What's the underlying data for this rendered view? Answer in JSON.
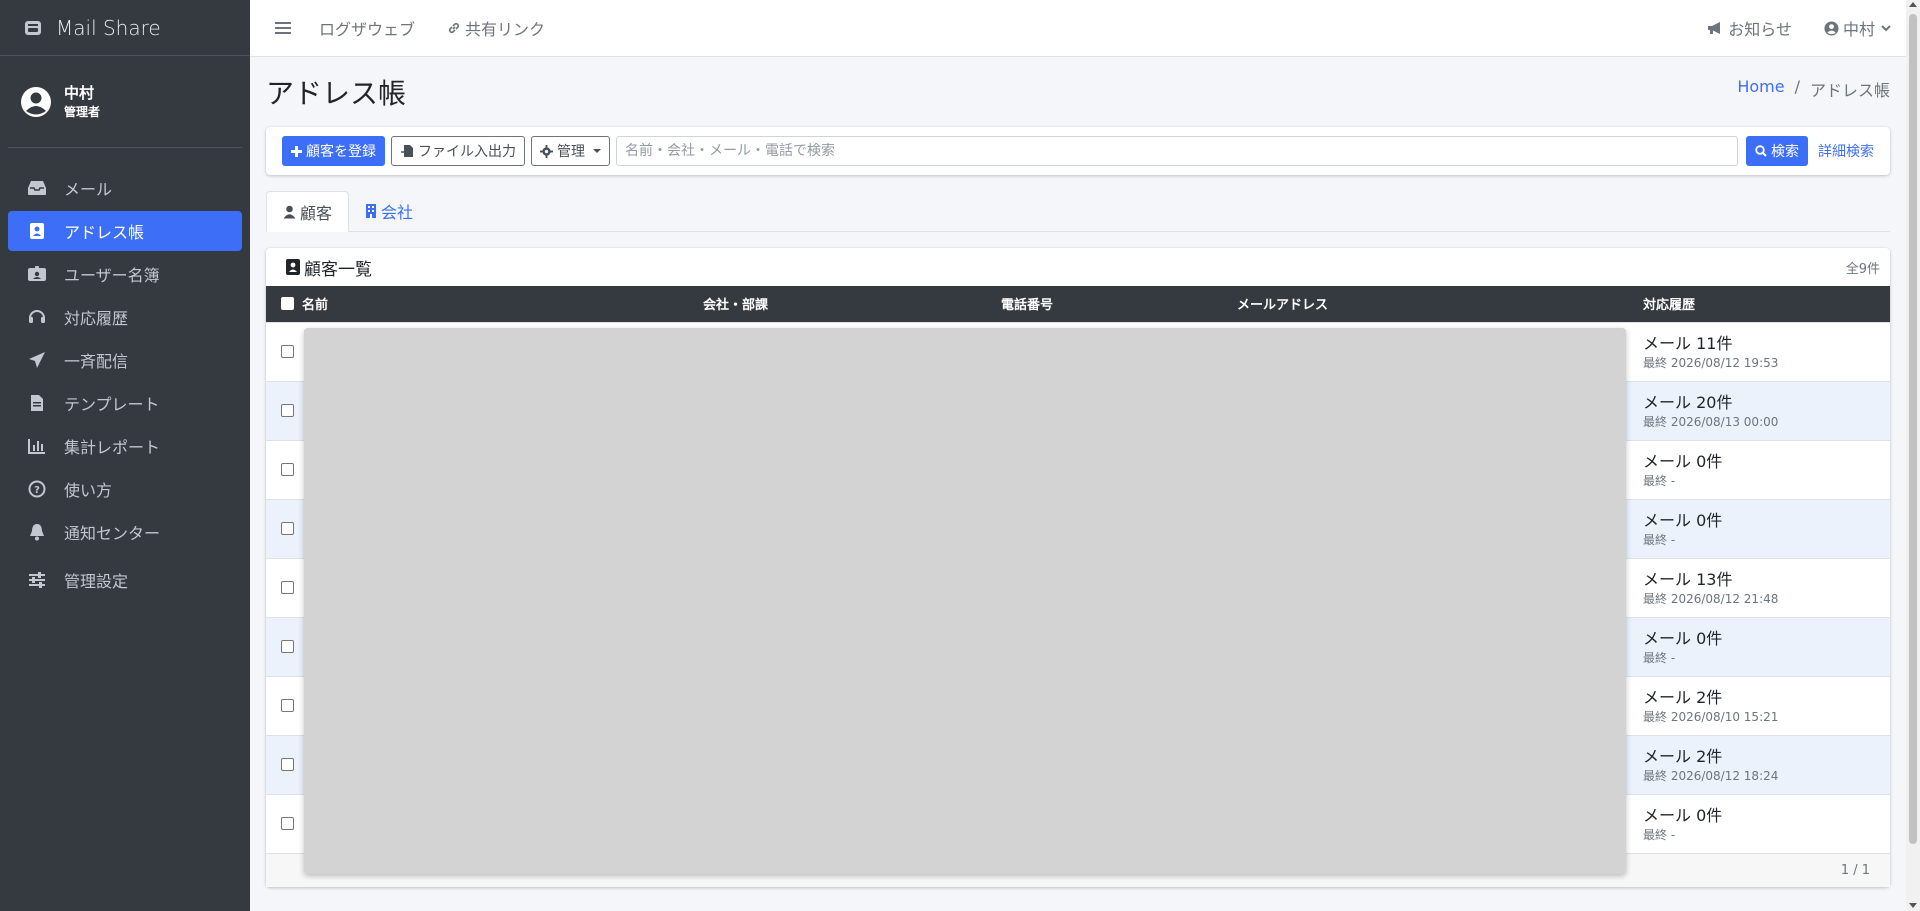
{
  "brand": {
    "name": "Mail Share",
    "icon": "mailbox-icon"
  },
  "user": {
    "name": "中村",
    "role": "管理者"
  },
  "sidebar": {
    "items": [
      {
        "label": "メール",
        "icon": "inbox-icon"
      },
      {
        "label": "アドレス帳",
        "icon": "address-book-icon",
        "active": true
      },
      {
        "label": "ユーザー名簿",
        "icon": "id-badge-icon"
      },
      {
        "label": "対応履歴",
        "icon": "headset-icon"
      },
      {
        "label": "一斉配信",
        "icon": "paper-plane-icon"
      },
      {
        "label": "テンプレート",
        "icon": "file-icon"
      },
      {
        "label": "集計レポート",
        "icon": "bar-chart-icon"
      },
      {
        "label": "使い方",
        "icon": "question-circle-icon"
      },
      {
        "label": "通知センター",
        "icon": "bell-icon"
      },
      {
        "label": "管理設定",
        "icon": "sliders-icon"
      }
    ]
  },
  "header": {
    "links": [
      {
        "label": "ログザウェブ"
      },
      {
        "label": "共有リンク",
        "icon": "link-icon"
      }
    ],
    "notice": "お知らせ",
    "user": "中村"
  },
  "page": {
    "title": "アドレス帳",
    "breadcrumb": {
      "home": "Home",
      "sep": "/",
      "current": "アドレス帳"
    }
  },
  "toolbar": {
    "register": "顧客を登録",
    "file_io": "ファイル入出力",
    "manage": "管理",
    "search_placeholder": "名前・会社・メール・電話で検索",
    "search": "検索",
    "advanced": "詳細検索"
  },
  "tabs": [
    {
      "label": "顧客",
      "icon": "user-icon",
      "active": true
    },
    {
      "label": "会社",
      "icon": "building-icon",
      "active": false
    }
  ],
  "list": {
    "title": "顧客一覧",
    "count": "全9件",
    "columns": [
      "名前",
      "会社・部課",
      "電話番号",
      "メールアドレス",
      "対応履歴"
    ],
    "rows": [
      {
        "history": "メール 11件",
        "last": "最終 2026/08/12 19:53"
      },
      {
        "history": "メール 20件",
        "last": "最終 2026/08/13 00:00"
      },
      {
        "history": "メール 0件",
        "last": "最終 -"
      },
      {
        "history": "メール 0件",
        "last": "最終 -"
      },
      {
        "history": "メール 13件",
        "last": "最終 2026/08/12 21:48"
      },
      {
        "history": "メール 0件",
        "last": "最終 -"
      },
      {
        "history": "メール 2件",
        "last": "最終 2026/08/10 15:21"
      },
      {
        "history": "メール 2件",
        "last": "最終 2026/08/12 18:24"
      },
      {
        "history": "メール 0件",
        "last": "最終 -"
      }
    ],
    "pagination": "1 / 1"
  },
  "colors": {
    "accent": "#3d6ef7",
    "sidebar": "#343a40",
    "table_head": "#343a40",
    "row_alt": "#ebf2fb"
  }
}
